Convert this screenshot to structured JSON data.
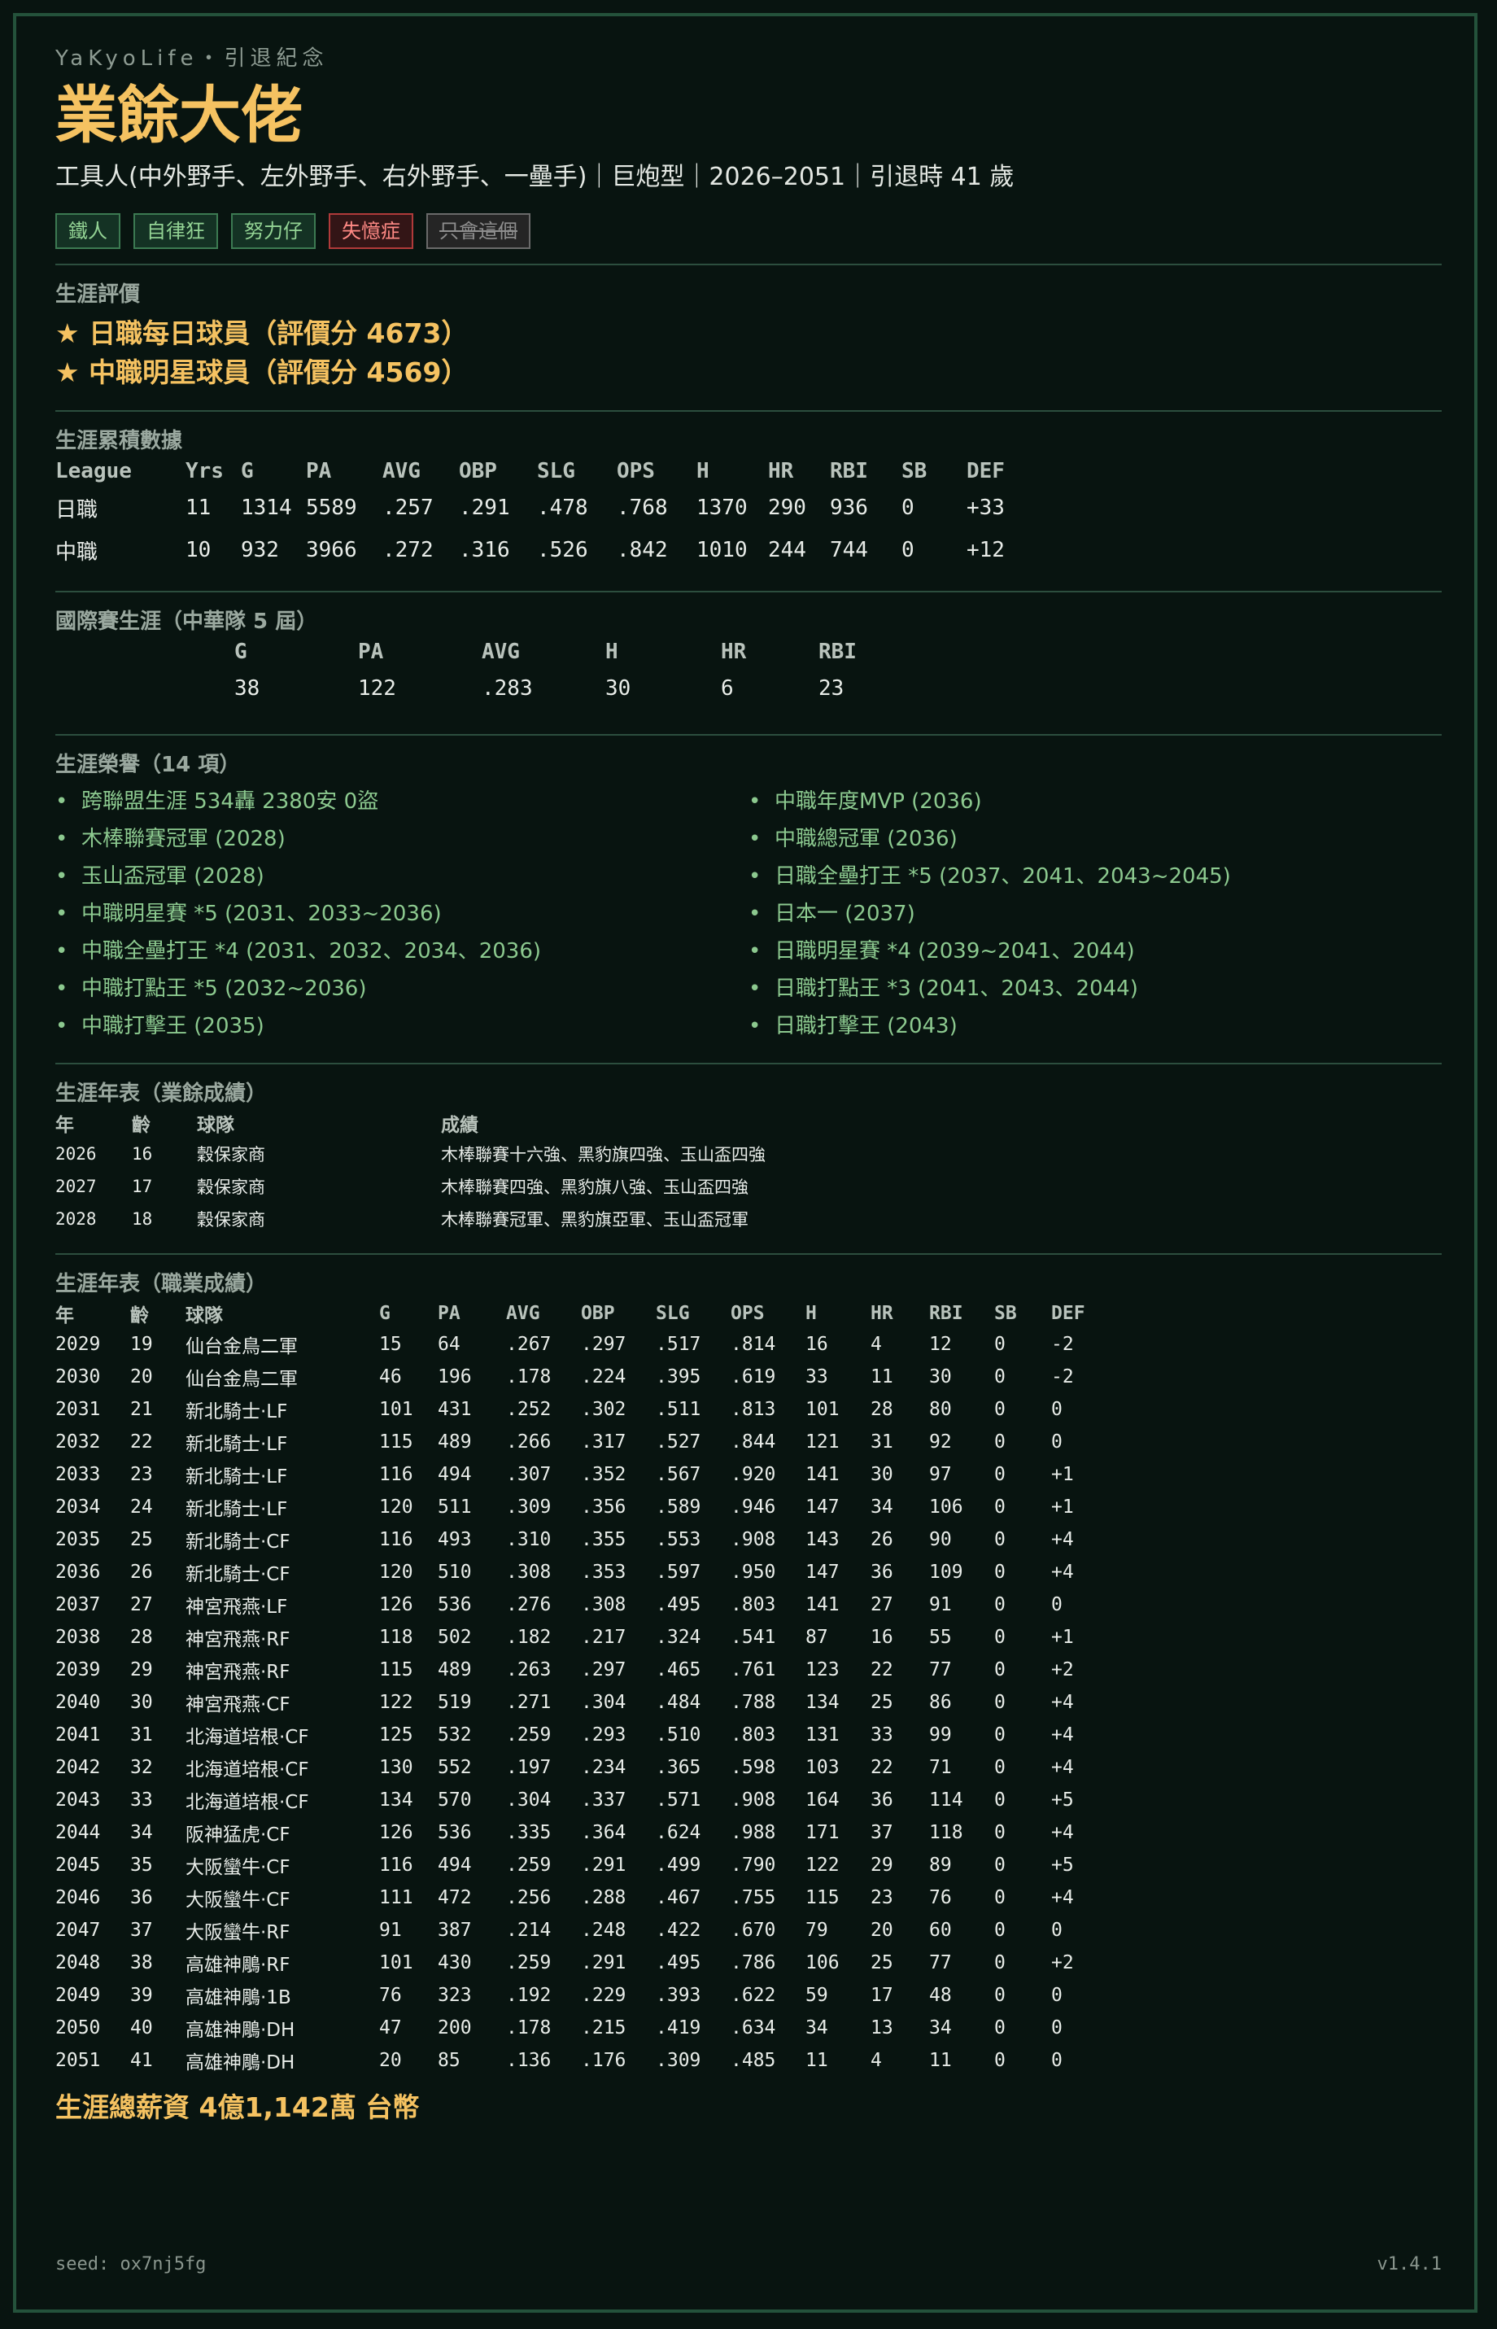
{
  "header": {
    "brand": "YaKyoLife・引退紀念",
    "title": "業餘大佬",
    "subtitle": "工具人(中外野手、左外野手、右外野手、一壘手)｜巨炮型｜2026–2051｜引退時 41 歲"
  },
  "tags": [
    {
      "label": "鐵人",
      "type": "good"
    },
    {
      "label": "自律狂",
      "type": "good"
    },
    {
      "label": "努力仔",
      "type": "good"
    },
    {
      "label": "失憶症",
      "type": "bad"
    },
    {
      "label": "只會這個",
      "type": "neutral"
    }
  ],
  "evaluation": {
    "title": "生涯評價",
    "items": [
      "★ 日職每日球員（評價分 4673）",
      "★ 中職明星球員（評價分 4569）"
    ]
  },
  "career_totals": {
    "title": "生涯累積數據",
    "headers": [
      "League",
      "Yrs",
      "G",
      "PA",
      "AVG",
      "OBP",
      "SLG",
      "OPS",
      "H",
      "HR",
      "RBI",
      "SB",
      "DEF"
    ],
    "rows": [
      [
        "日職",
        "11",
        "1314",
        "5589",
        ".257",
        ".291",
        ".478",
        ".768",
        "1370",
        "290",
        "936",
        "0",
        "+33"
      ],
      [
        "中職",
        "10",
        "932",
        "3966",
        ".272",
        ".316",
        ".526",
        ".842",
        "1010",
        "244",
        "744",
        "0",
        "+12"
      ]
    ]
  },
  "international": {
    "title": "國際賽生涯（中華隊 5 屆）",
    "headers": [
      "G",
      "PA",
      "AVG",
      "H",
      "HR",
      "RBI"
    ],
    "row": [
      "38",
      "122",
      ".283",
      "30",
      "6",
      "23"
    ]
  },
  "honors": {
    "title": "生涯榮譽（14 項）",
    "left": [
      "跨聯盟生涯 534轟 2380安 0盜",
      "木棒聯賽冠軍 (2028)",
      "玉山盃冠軍 (2028)",
      "中職明星賽 *5 (2031、2033~2036)",
      "中職全壘打王 *4 (2031、2032、2034、2036)",
      "中職打點王 *5 (2032~2036)",
      "中職打擊王 (2035)"
    ],
    "right": [
      "中職年度MVP (2036)",
      "中職總冠軍 (2036)",
      "日職全壘打王 *5 (2037、2041、2043~2045)",
      "日本一 (2037)",
      "日職明星賽 *4 (2039~2041、2044)",
      "日職打點王 *3 (2041、2043、2044)",
      "日職打擊王 (2043)"
    ]
  },
  "amateur": {
    "title": "生涯年表（業餘成績）",
    "headers": [
      "年",
      "齡",
      "球隊",
      "成績"
    ],
    "rows": [
      [
        "2026",
        "16",
        "穀保家商",
        "木棒聯賽十六強、黑豹旗四強、玉山盃四強"
      ],
      [
        "2027",
        "17",
        "穀保家商",
        "木棒聯賽四強、黑豹旗八強、玉山盃四強"
      ],
      [
        "2028",
        "18",
        "穀保家商",
        "木棒聯賽冠軍、黑豹旗亞軍、玉山盃冠軍"
      ]
    ]
  },
  "professional": {
    "title": "生涯年表（職業成績）",
    "headers": [
      "年",
      "齡",
      "球隊",
      "G",
      "PA",
      "AVG",
      "OBP",
      "SLG",
      "OPS",
      "H",
      "HR",
      "RBI",
      "SB",
      "DEF"
    ],
    "rows": [
      [
        "2029",
        "19",
        "仙台金鳥二軍",
        "15",
        "64",
        ".267",
        ".297",
        ".517",
        ".814",
        "16",
        "4",
        "12",
        "0",
        "-2"
      ],
      [
        "2030",
        "20",
        "仙台金鳥二軍",
        "46",
        "196",
        ".178",
        ".224",
        ".395",
        ".619",
        "33",
        "11",
        "30",
        "0",
        "-2"
      ],
      [
        "2031",
        "21",
        "新北騎士·LF",
        "101",
        "431",
        ".252",
        ".302",
        ".511",
        ".813",
        "101",
        "28",
        "80",
        "0",
        "0"
      ],
      [
        "2032",
        "22",
        "新北騎士·LF",
        "115",
        "489",
        ".266",
        ".317",
        ".527",
        ".844",
        "121",
        "31",
        "92",
        "0",
        "0"
      ],
      [
        "2033",
        "23",
        "新北騎士·LF",
        "116",
        "494",
        ".307",
        ".352",
        ".567",
        ".920",
        "141",
        "30",
        "97",
        "0",
        "+1"
      ],
      [
        "2034",
        "24",
        "新北騎士·LF",
        "120",
        "511",
        ".309",
        ".356",
        ".589",
        ".946",
        "147",
        "34",
        "106",
        "0",
        "+1"
      ],
      [
        "2035",
        "25",
        "新北騎士·CF",
        "116",
        "493",
        ".310",
        ".355",
        ".553",
        ".908",
        "143",
        "26",
        "90",
        "0",
        "+4"
      ],
      [
        "2036",
        "26",
        "新北騎士·CF",
        "120",
        "510",
        ".308",
        ".353",
        ".597",
        ".950",
        "147",
        "36",
        "109",
        "0",
        "+4"
      ],
      [
        "2037",
        "27",
        "神宮飛燕·LF",
        "126",
        "536",
        ".276",
        ".308",
        ".495",
        ".803",
        "141",
        "27",
        "91",
        "0",
        "0"
      ],
      [
        "2038",
        "28",
        "神宮飛燕·RF",
        "118",
        "502",
        ".182",
        ".217",
        ".324",
        ".541",
        "87",
        "16",
        "55",
        "0",
        "+1"
      ],
      [
        "2039",
        "29",
        "神宮飛燕·RF",
        "115",
        "489",
        ".263",
        ".297",
        ".465",
        ".761",
        "123",
        "22",
        "77",
        "0",
        "+2"
      ],
      [
        "2040",
        "30",
        "神宮飛燕·CF",
        "122",
        "519",
        ".271",
        ".304",
        ".484",
        ".788",
        "134",
        "25",
        "86",
        "0",
        "+4"
      ],
      [
        "2041",
        "31",
        "北海道培根·CF",
        "125",
        "532",
        ".259",
        ".293",
        ".510",
        ".803",
        "131",
        "33",
        "99",
        "0",
        "+4"
      ],
      [
        "2042",
        "32",
        "北海道培根·CF",
        "130",
        "552",
        ".197",
        ".234",
        ".365",
        ".598",
        "103",
        "22",
        "71",
        "0",
        "+4"
      ],
      [
        "2043",
        "33",
        "北海道培根·CF",
        "134",
        "570",
        ".304",
        ".337",
        ".571",
        ".908",
        "164",
        "36",
        "114",
        "0",
        "+5"
      ],
      [
        "2044",
        "34",
        "阪神猛虎·CF",
        "126",
        "536",
        ".335",
        ".364",
        ".624",
        ".988",
        "171",
        "37",
        "118",
        "0",
        "+4"
      ],
      [
        "2045",
        "35",
        "大阪蠻牛·CF",
        "116",
        "494",
        ".259",
        ".291",
        ".499",
        ".790",
        "122",
        "29",
        "89",
        "0",
        "+5"
      ],
      [
        "2046",
        "36",
        "大阪蠻牛·CF",
        "111",
        "472",
        ".256",
        ".288",
        ".467",
        ".755",
        "115",
        "23",
        "76",
        "0",
        "+4"
      ],
      [
        "2047",
        "37",
        "大阪蠻牛·RF",
        "91",
        "387",
        ".214",
        ".248",
        ".422",
        ".670",
        "79",
        "20",
        "60",
        "0",
        "0"
      ],
      [
        "2048",
        "38",
        "高雄神鵰·RF",
        "101",
        "430",
        ".259",
        ".291",
        ".495",
        ".786",
        "106",
        "25",
        "77",
        "0",
        "+2"
      ],
      [
        "2049",
        "39",
        "高雄神鵰·1B",
        "76",
        "323",
        ".192",
        ".229",
        ".393",
        ".622",
        "59",
        "17",
        "48",
        "0",
        "0"
      ],
      [
        "2050",
        "40",
        "高雄神鵰·DH",
        "47",
        "200",
        ".178",
        ".215",
        ".419",
        ".634",
        "34",
        "13",
        "34",
        "0",
        "0"
      ],
      [
        "2051",
        "41",
        "高雄神鵰·DH",
        "20",
        "85",
        ".136",
        ".176",
        ".309",
        ".485",
        "11",
        "4",
        "11",
        "0",
        "0"
      ]
    ]
  },
  "salary": "生涯總薪資 4億1,142萬 台幣",
  "footer": {
    "seed": "seed: ox7nj5fg",
    "version": "v1.4.1"
  }
}
